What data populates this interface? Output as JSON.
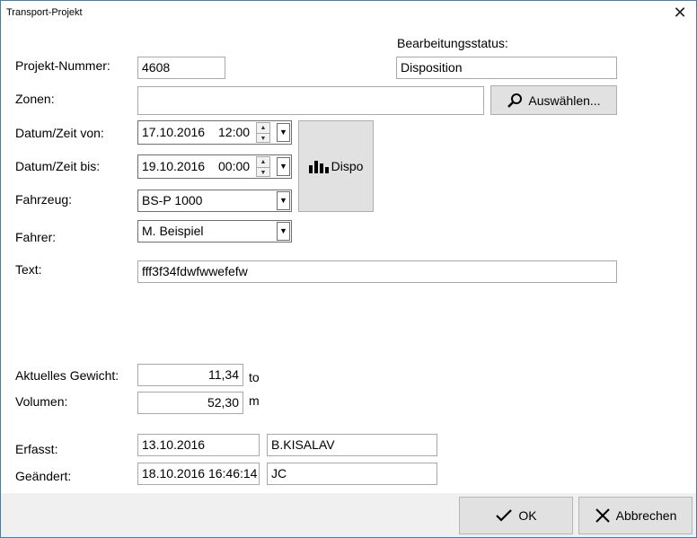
{
  "window": {
    "title": "Transport-Projekt",
    "close_glyph": "✕"
  },
  "form": {
    "projekt_nummer": {
      "label": "Projekt-Nummer:",
      "value": "4608"
    },
    "status": {
      "label": "Bearbeitungsstatus:",
      "value": "Disposition"
    },
    "zonen": {
      "label": "Zonen:",
      "value": "",
      "button": "Auswählen..."
    },
    "von": {
      "label": "Datum/Zeit von:",
      "date": "17.10.2016",
      "time": "12:00"
    },
    "bis": {
      "label": "Datum/Zeit bis:",
      "date": "19.10.2016",
      "time": "00:00"
    },
    "dispo_button": "Dispo",
    "fahrzeug": {
      "label": "Fahrzeug:",
      "value": "BS-P 1000"
    },
    "fahrer": {
      "label": "Fahrer:",
      "value": "M. Beispiel"
    },
    "text": {
      "label": "Text:",
      "value": "fff3f34fdwfwwefefw"
    },
    "gewicht": {
      "label": "Aktuelles Gewicht:",
      "value": "11,34",
      "unit": "to"
    },
    "volumen": {
      "label": "Volumen:",
      "value": "52,30",
      "unit": "m"
    },
    "erfasst": {
      "label": "Erfasst:",
      "date": "13.10.2016",
      "user": "B.KISALAV"
    },
    "geaendert": {
      "label": "Geändert:",
      "date": "18.10.2016 16:46:14",
      "user": "JC"
    }
  },
  "footer": {
    "ok_label": "OK",
    "cancel_label": "Abbrechen"
  },
  "icons": [
    "close-icon",
    "search-icon",
    "spin-up-icon",
    "spin-down-icon",
    "dropdown-arrow-icon",
    "bar-chart-icon",
    "checkmark-icon",
    "x-icon"
  ]
}
